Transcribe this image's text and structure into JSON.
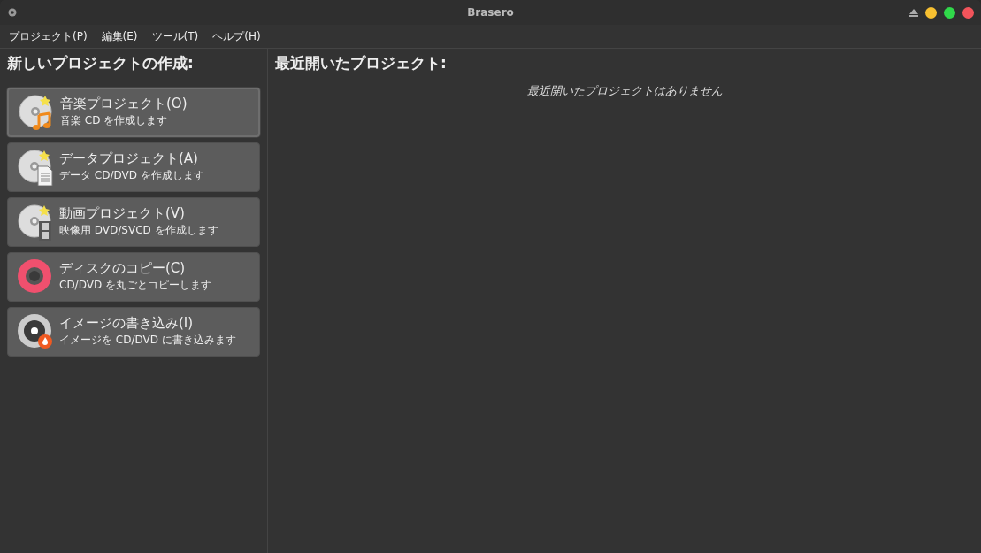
{
  "window": {
    "title": "Brasero"
  },
  "menu": [
    {
      "label": "プロジェクト(P)"
    },
    {
      "label": "編集(E)"
    },
    {
      "label": "ツール(T)"
    },
    {
      "label": "ヘルプ(H)"
    }
  ],
  "new_project": {
    "heading": "新しいプロジェクトの作成:",
    "buttons": [
      {
        "kind": "audio",
        "title": "音楽プロジェクト(O)",
        "description": "音楽 CD を作成します",
        "focused": true
      },
      {
        "kind": "data",
        "title": "データプロジェクト(A)",
        "description": "データ CD/DVD を作成します",
        "focused": false
      },
      {
        "kind": "video",
        "title": "動画プロジェクト(V)",
        "description": "映像用 DVD/SVCD を作成します",
        "focused": false
      },
      {
        "kind": "copy",
        "title": "ディスクのコピー(C)",
        "description": "CD/DVD を丸ごとコピーします",
        "focused": false
      },
      {
        "kind": "burn",
        "title": "イメージの書き込み(I)",
        "description": "イメージを CD/DVD に書き込みます",
        "focused": false
      }
    ]
  },
  "recent": {
    "heading": "最近開いたプロジェクト:",
    "empty_message": "最近開いたプロジェクトはありません"
  }
}
